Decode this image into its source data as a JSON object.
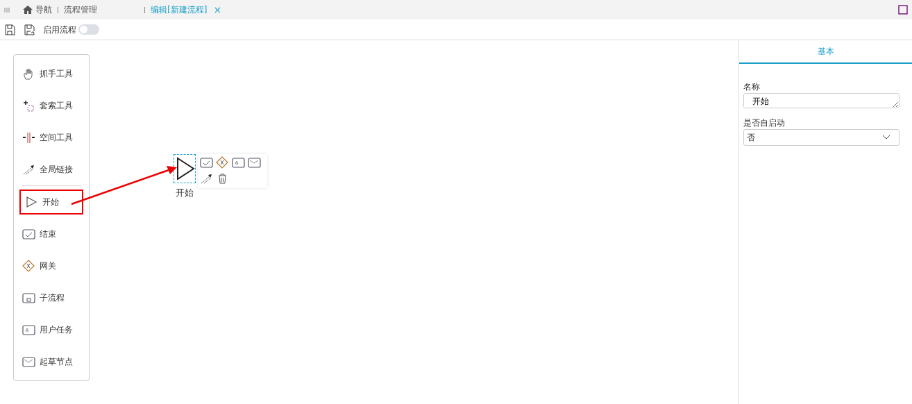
{
  "tabs": [
    {
      "label": "导航",
      "kind": "home",
      "selected": false
    },
    {
      "label": "流程管理",
      "kind": "plain",
      "selected": false
    },
    {
      "label": "编辑[新建流程]",
      "kind": "plain",
      "selected": true,
      "close": "×"
    }
  ],
  "toolbar": {
    "toggle": {
      "label": "启用流程",
      "on": false
    }
  },
  "palette": {
    "tools": [
      {
        "label": "抓手工具",
        "kind": "hand",
        "highlighted": false
      },
      {
        "label": "套索工具",
        "kind": "lasso",
        "highlighted": false
      },
      {
        "label": "空间工具",
        "kind": "space",
        "highlighted": false
      },
      {
        "label": "全局链接",
        "kind": "connect",
        "highlighted": false
      }
    ],
    "elements": [
      {
        "label": "开始",
        "kind": "start",
        "highlighted": true
      },
      {
        "label": "结束",
        "kind": "end",
        "highlighted": false
      },
      {
        "label": "网关",
        "kind": "gateway",
        "highlighted": false
      },
      {
        "label": "子流程",
        "kind": "subprocess",
        "highlighted": false
      },
      {
        "label": "用户任务",
        "kind": "usertask",
        "highlighted": false
      },
      {
        "label": "起草节点",
        "kind": "draft",
        "highlighted": false
      }
    ]
  },
  "node": {
    "label": "开始",
    "selected": true,
    "context_pad": [
      {
        "kind": "end"
      },
      {
        "kind": "gateway"
      },
      {
        "kind": "usertask"
      },
      {
        "kind": "draft"
      },
      {
        "kind": "connect"
      },
      {
        "kind": "delete"
      }
    ]
  },
  "properties": {
    "tabs": [
      {
        "label": "基本",
        "selected": true
      }
    ],
    "fields": [
      {
        "label": "名称",
        "kind": "textarea",
        "value": "开始"
      },
      {
        "label": "是否自启动",
        "kind": "select",
        "value": "否"
      }
    ]
  }
}
